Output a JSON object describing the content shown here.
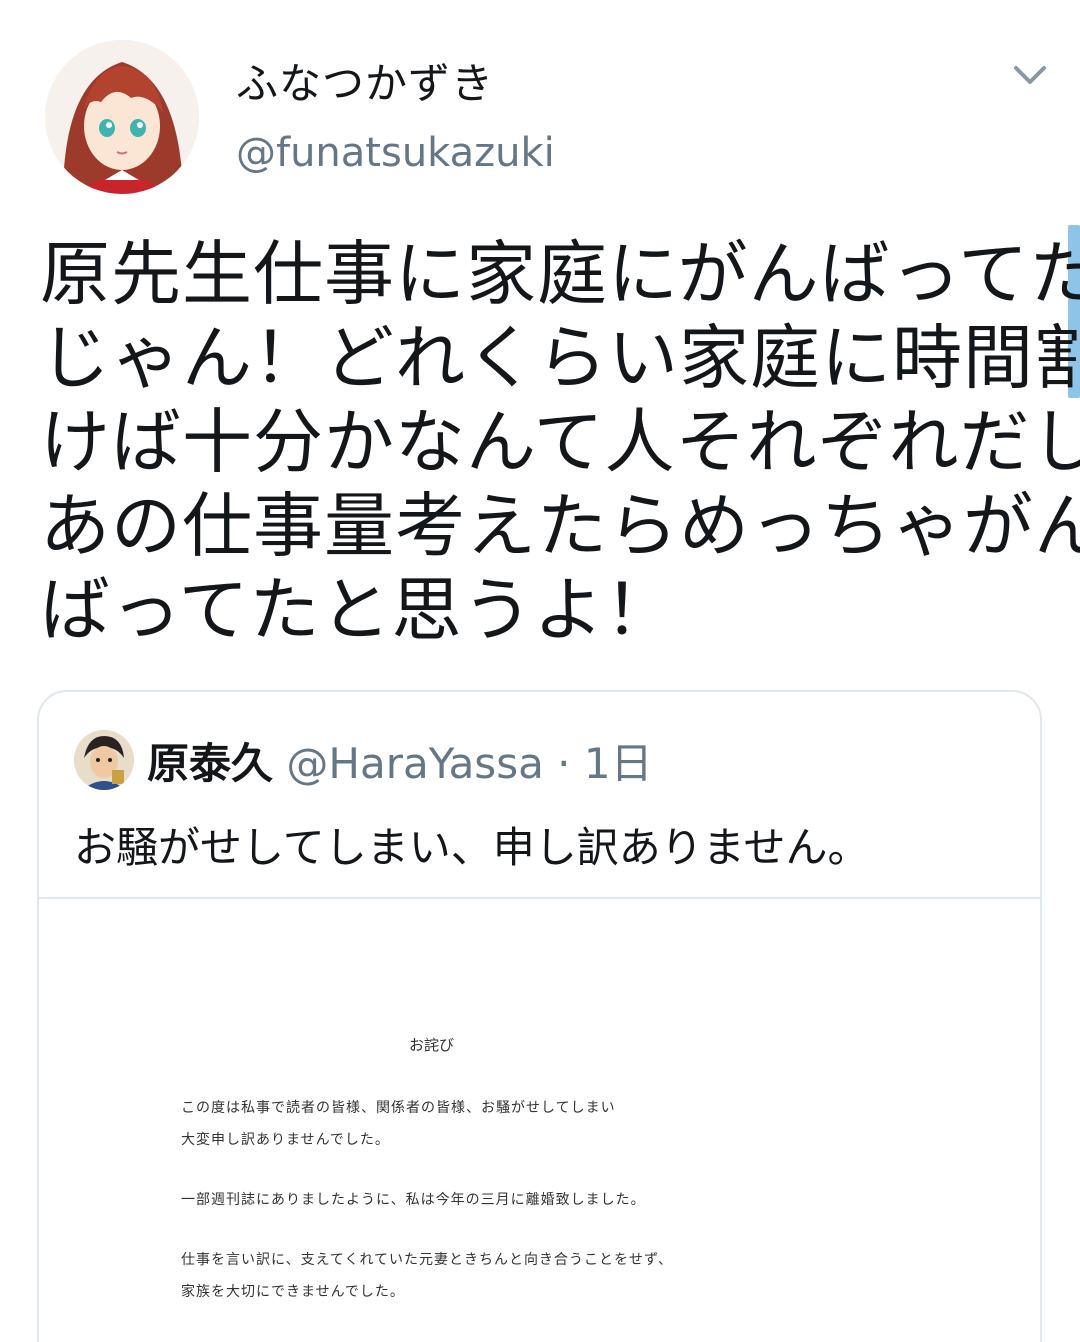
{
  "user": {
    "display_name": "ふなつかずき",
    "handle": "@funatsukazuki"
  },
  "tweet": {
    "lines": [
      "原先生仕事に家庭にがんばってた",
      "じゃん！どれくらい家庭に時間割",
      "けば十分かなんて人それぞれだし",
      "あの仕事量考えたらめっちゃがん",
      "ばってたと思うよ！"
    ]
  },
  "quoted": {
    "name": "原泰久",
    "handle": "@HaraYassa",
    "dot": "·",
    "time": "1日",
    "text": "お騒がせしてしまい、申し訳ありません。",
    "document": {
      "title": "お詫び",
      "lines": [
        "この度は私事で読者の皆様、関係者の皆様、お騒がせしてしまい",
        "大変申し訳ありませんでした。",
        "一部週刊誌にありましたように、私は今年の三月に離婚致しました。",
        "仕事を言い訳に、支えてくれていた元妻ときちんと向き合うことをせず、",
        "家族を大切にできませんでした。"
      ]
    }
  },
  "icons": {
    "caret": "chevron-down-icon",
    "avatar": "avatar",
    "quoted_avatar": "avatar"
  },
  "colors": {
    "text": "#14171a",
    "secondary": "#657786",
    "border": "#e1e8ed",
    "scrollbar": "#8ec4e8"
  }
}
